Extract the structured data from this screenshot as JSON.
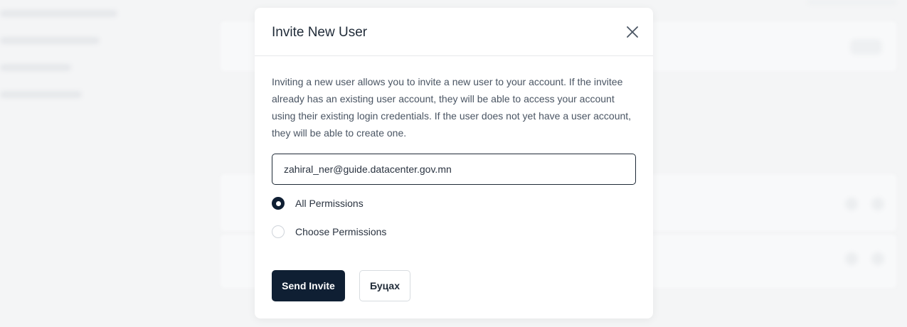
{
  "modal": {
    "title": "Invite New User",
    "close_icon": "close-icon",
    "description": "Inviting a new user allows you to invite a new user to your account. If the invitee already has an existing user account, they will be able to access your account using their existing login credentials. If the user does not yet have a user account, they will be able to create one.",
    "email_value": "zahiral_ner@guide.datacenter.gov.mn",
    "permissions": [
      {
        "label": "All Permissions",
        "selected": true
      },
      {
        "label": "Choose Permissions",
        "selected": false
      }
    ],
    "send_button": "Send Invite",
    "cancel_button": "Буцах"
  },
  "colors": {
    "primary": "#0f1f33",
    "text": "#1f2a37",
    "muted_text": "#4a5563",
    "border": "#d8dce0",
    "backdrop": "#f4f5f6"
  }
}
